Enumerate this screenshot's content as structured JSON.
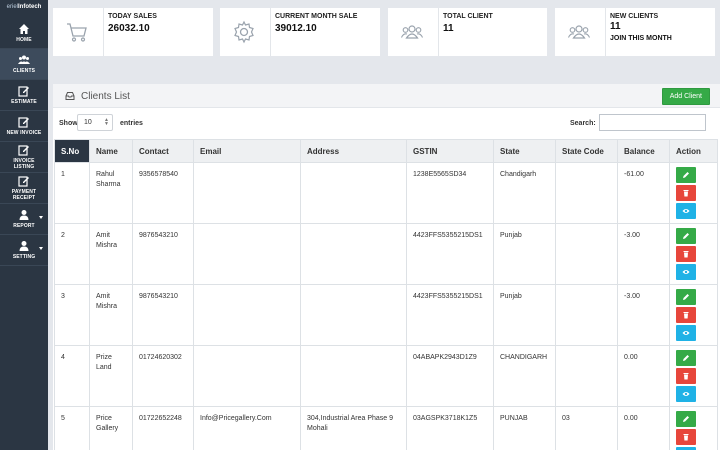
{
  "brand": {
    "logo_text_1": "eriel",
    "logo_text_2": "Infotech"
  },
  "sidebar": {
    "items": [
      {
        "label": "HOME",
        "icon": "home-icon"
      },
      {
        "label": "CLIENTS",
        "icon": "users-icon"
      },
      {
        "label": "ESTIMATE",
        "icon": "edit-icon"
      },
      {
        "label": "NEW INVOICE",
        "icon": "edit-icon"
      },
      {
        "label": "INVOICE LISTING",
        "icon": "edit-icon"
      },
      {
        "label": "PAYMENT RECEIPT",
        "icon": "edit-icon"
      },
      {
        "label": "REPORT",
        "icon": "user-icon"
      },
      {
        "label": "SETTING",
        "icon": "user-icon"
      }
    ]
  },
  "stats": [
    {
      "title": "TODAY SALES",
      "value": "26032.10",
      "icon": "cart-icon"
    },
    {
      "title": "CURRENT MONTH SALE",
      "value": "39012.10",
      "icon": "gear-icon"
    },
    {
      "title": "TOTAL CLIENT",
      "value": "11",
      "icon": "group-icon"
    },
    {
      "title": "NEW CLIENTS",
      "value": "11",
      "sub": "JOIN THIS MONTH",
      "icon": "group-icon"
    }
  ],
  "panel": {
    "title": "Clients List",
    "add_button": "Add Client",
    "show_label": "Show",
    "entries_value": "10",
    "entries_label": "entries",
    "search_label": "Search:",
    "search_value": ""
  },
  "table": {
    "headers": [
      "S.No",
      "Name",
      "Contact",
      "Email",
      "Address",
      "GSTIN",
      "State",
      "State Code",
      "Balance",
      "Action"
    ],
    "rows": [
      {
        "sno": "1",
        "name": "Rahul Sharma",
        "contact": "9356578540",
        "email": "",
        "address": "",
        "gstin": "1238E5565SD34",
        "state": "Chandigarh",
        "state_code": "",
        "balance": "-61.00"
      },
      {
        "sno": "2",
        "name": "Amit Mishra",
        "contact": "9876543210",
        "email": "",
        "address": "",
        "gstin": "4423FFS5355215DS1",
        "state": "Punjab",
        "state_code": "",
        "balance": "-3.00"
      },
      {
        "sno": "3",
        "name": "Amit Mishra",
        "contact": "9876543210",
        "email": "",
        "address": "",
        "gstin": "4423FFS5355215DS1",
        "state": "Punjab",
        "state_code": "",
        "balance": "-3.00"
      },
      {
        "sno": "4",
        "name": "Prize Land",
        "contact": "01724620302",
        "email": "",
        "address": "",
        "gstin": "04ABAPK2943D1Z9",
        "state": "CHANDIGARH",
        "state_code": "",
        "balance": "0.00"
      },
      {
        "sno": "5",
        "name": "Price Gallery",
        "contact": "01722652248",
        "email": "Info@Pricegallery.Com",
        "address": "304,Industrial Area Phase 9 Mohali",
        "gstin": "03AGSPK3718K1Z5",
        "state": "PUNJAB",
        "state_code": "03",
        "balance": "0.00"
      }
    ]
  },
  "colors": {
    "sidebar": "#2b3643",
    "accent_green": "#35aa47",
    "danger": "#e7463b",
    "info": "#1fb2e6"
  }
}
